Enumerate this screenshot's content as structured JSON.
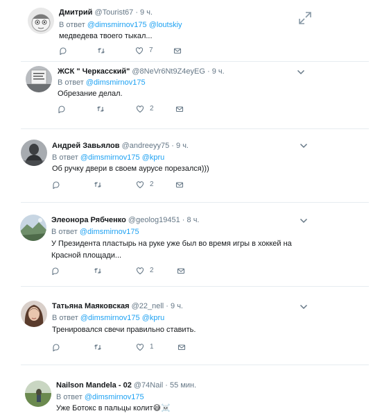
{
  "ui": {
    "reply_prefix": "В ответ",
    "dot": "·"
  },
  "tweets": [
    {
      "name": "Дмитрий",
      "handle": "@Tourist67",
      "time": "9 ч.",
      "reply_to": [
        "@dimsmirnov175",
        "@loutskiy"
      ],
      "text": "медведева твоего тыкал...",
      "likes": "7",
      "avatar": "cartoon-face-avatar"
    },
    {
      "name": "ЖСК \" Черкасский\"",
      "handle": "@8NeVr6Nt9Z4eyEG",
      "time": "9 ч.",
      "reply_to": [
        "@dimsmirnov175"
      ],
      "text": "Обрезание делал.",
      "likes": "2",
      "avatar": "sign-photo-avatar"
    },
    {
      "name": "Андрей Завьялов",
      "handle": "@andreeyy75",
      "time": "9 ч.",
      "reply_to": [
        "@dimsmirnov175",
        "@kpru"
      ],
      "text": "Об ручку двери в своем аурусе порезался)))",
      "likes": "2",
      "avatar": "statue-photo-avatar"
    },
    {
      "name": "Элеонора Рябченко",
      "handle": "@geolog19451",
      "time": "8 ч.",
      "reply_to": [
        "@dimsmirnov175"
      ],
      "text": "У Президента пластырь на руке уже был во время игры в хоккей на Красной площади...",
      "likes": "2",
      "avatar": "landscape-photo-avatar"
    },
    {
      "name": "Татьяна Маяковская",
      "handle": "@22_nell",
      "time": "9 ч.",
      "reply_to": [
        "@dimsmirnov175",
        "@kpru"
      ],
      "text": "Тренировался свечи правильно ставить.",
      "likes": "1",
      "avatar": "woman-portrait-avatar"
    },
    {
      "name": "Nailson Mandela - 02",
      "handle": "@74Nail",
      "time": "55 мин.",
      "reply_to": [
        "@dimsmirnov175"
      ],
      "text": "Уже Ботокс в пальцы колит",
      "likes": "",
      "avatar": "field-photo-avatar"
    }
  ],
  "emoji": {
    "sweat_smile": "😅",
    "skull_crossbones": "☠️"
  },
  "colors": {
    "link": "#1da1f2",
    "muted": "#657786",
    "text": "#14171a",
    "divider": "#e6ecf0"
  }
}
